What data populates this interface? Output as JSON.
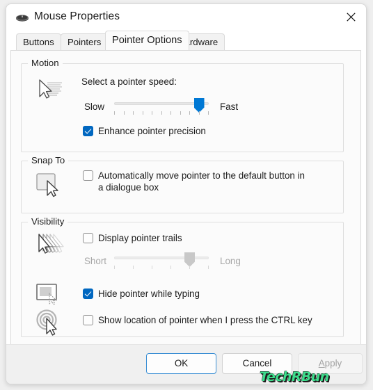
{
  "window": {
    "title": "Mouse Properties",
    "icon": "mouse-icon",
    "close_label": "Close"
  },
  "tabs": [
    {
      "label": "Buttons",
      "active": false
    },
    {
      "label": "Pointers",
      "active": false
    },
    {
      "label": "Pointer Options",
      "active": true
    },
    {
      "label": "Hardware",
      "active": false
    }
  ],
  "motion": {
    "group_title": "Motion",
    "icon": "pointer-speed-icon",
    "prompt": "Select a pointer speed:",
    "slider": {
      "min_label": "Slow",
      "max_label": "Fast",
      "value": 10,
      "min": 1,
      "max": 11,
      "ticks": 11,
      "disabled": false
    },
    "enhance_precision": {
      "label": "Enhance pointer precision",
      "checked": true
    }
  },
  "snap_to": {
    "group_title": "Snap To",
    "icon": "default-button-icon",
    "auto_move": {
      "label": "Automatically move pointer to the default button in a dialogue box",
      "checked": false
    }
  },
  "visibility": {
    "group_title": "Visibility",
    "trails": {
      "icon": "pointer-trails-icon",
      "label": "Display pointer trails",
      "checked": false,
      "slider": {
        "min_label": "Short",
        "max_label": "Long",
        "value": 5,
        "min": 1,
        "max": 6,
        "ticks": 6,
        "disabled": true
      }
    },
    "hide_while_typing": {
      "icon": "hide-pointer-typing-icon",
      "label": "Hide pointer while typing",
      "checked": true
    },
    "show_location": {
      "icon": "locate-pointer-icon",
      "label": "Show location of pointer when I press the CTRL key",
      "checked": false
    }
  },
  "watermark": {
    "text": "TechRBun",
    "color": "#3ddc8c"
  },
  "footer": {
    "ok": "OK",
    "cancel": "Cancel",
    "apply_accel": "A",
    "apply_rest": "pply",
    "apply_disabled": true
  },
  "colors": {
    "accent": "#0078d4",
    "checkbox_fill": "#0067c0",
    "focus_border": "#3b8fd4"
  }
}
